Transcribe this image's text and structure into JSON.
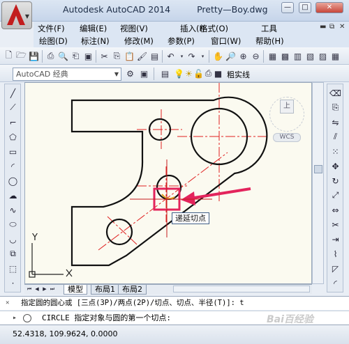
{
  "window": {
    "app_name": "Autodesk AutoCAD 2014",
    "file_name": "Pretty—Boy.dwg",
    "minimize": "—",
    "restore": "□",
    "close": "✕"
  },
  "menu_row1": [
    "文件(F)",
    "编辑(E)",
    "视图(V)",
    "插入(I)",
    "格式(O)",
    "工具"
  ],
  "menu_row2": [
    "绘图(D)",
    "标注(N)",
    "修改(M)",
    "参数(P)",
    "窗口(W)",
    "帮助(H)"
  ],
  "workspace": {
    "selected": "AutoCAD 经典"
  },
  "layer": {
    "name": "粗实线"
  },
  "viewcube": {
    "face": "上",
    "wcs": "WCS"
  },
  "ucs": {
    "x": "X",
    "y": "Y"
  },
  "tooltip": {
    "text": "递延切点"
  },
  "tabs": [
    "模型",
    "布局1",
    "布局2"
  ],
  "command": {
    "history": "指定圆的圆心或 [三点(3P)/两点(2P)/切点、切点、半径(T)]: t",
    "current": "CIRCLE 指定对象与圆的第一个切点:"
  },
  "status": {
    "coordinates": "52.4318, 109.9624, 0.0000"
  },
  "watermark": "Bai百经验",
  "colors": {
    "accent_red": "#e3245c",
    "center_line": "#e02020",
    "background": "#fbfaf0"
  }
}
